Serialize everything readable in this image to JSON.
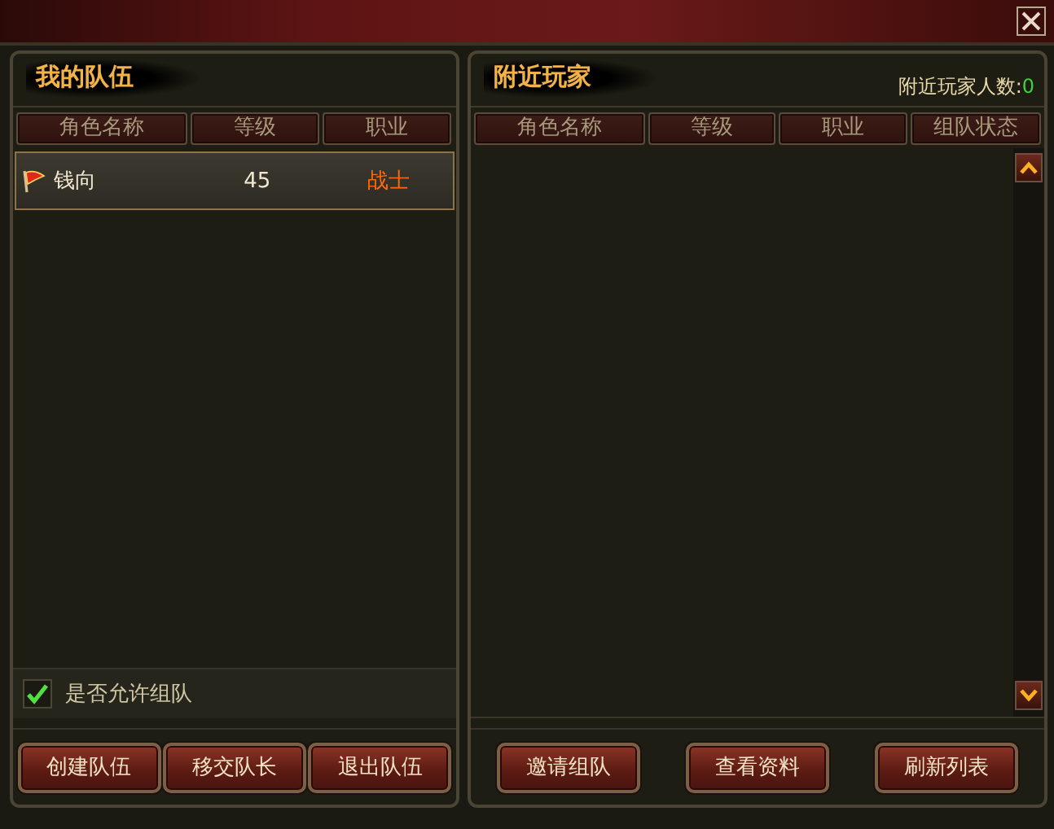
{
  "my_team": {
    "title": "我的队伍",
    "columns": [
      "角色名称",
      "等级",
      "职业"
    ],
    "members": [
      {
        "name": "钱向",
        "level": "45",
        "class": "战士",
        "leader": true,
        "selected": true
      }
    ],
    "allow_team": {
      "label": "是否允许组队",
      "checked": true
    },
    "buttons": [
      "创建队伍",
      "移交队长",
      "退出队伍"
    ]
  },
  "nearby": {
    "title": "附近玩家",
    "count_label": "附近玩家人数:",
    "count": "0",
    "columns": [
      "角色名称",
      "等级",
      "职业",
      "组队状态"
    ],
    "buttons": [
      "邀请组队",
      "查看资料",
      "刷新列表"
    ]
  }
}
